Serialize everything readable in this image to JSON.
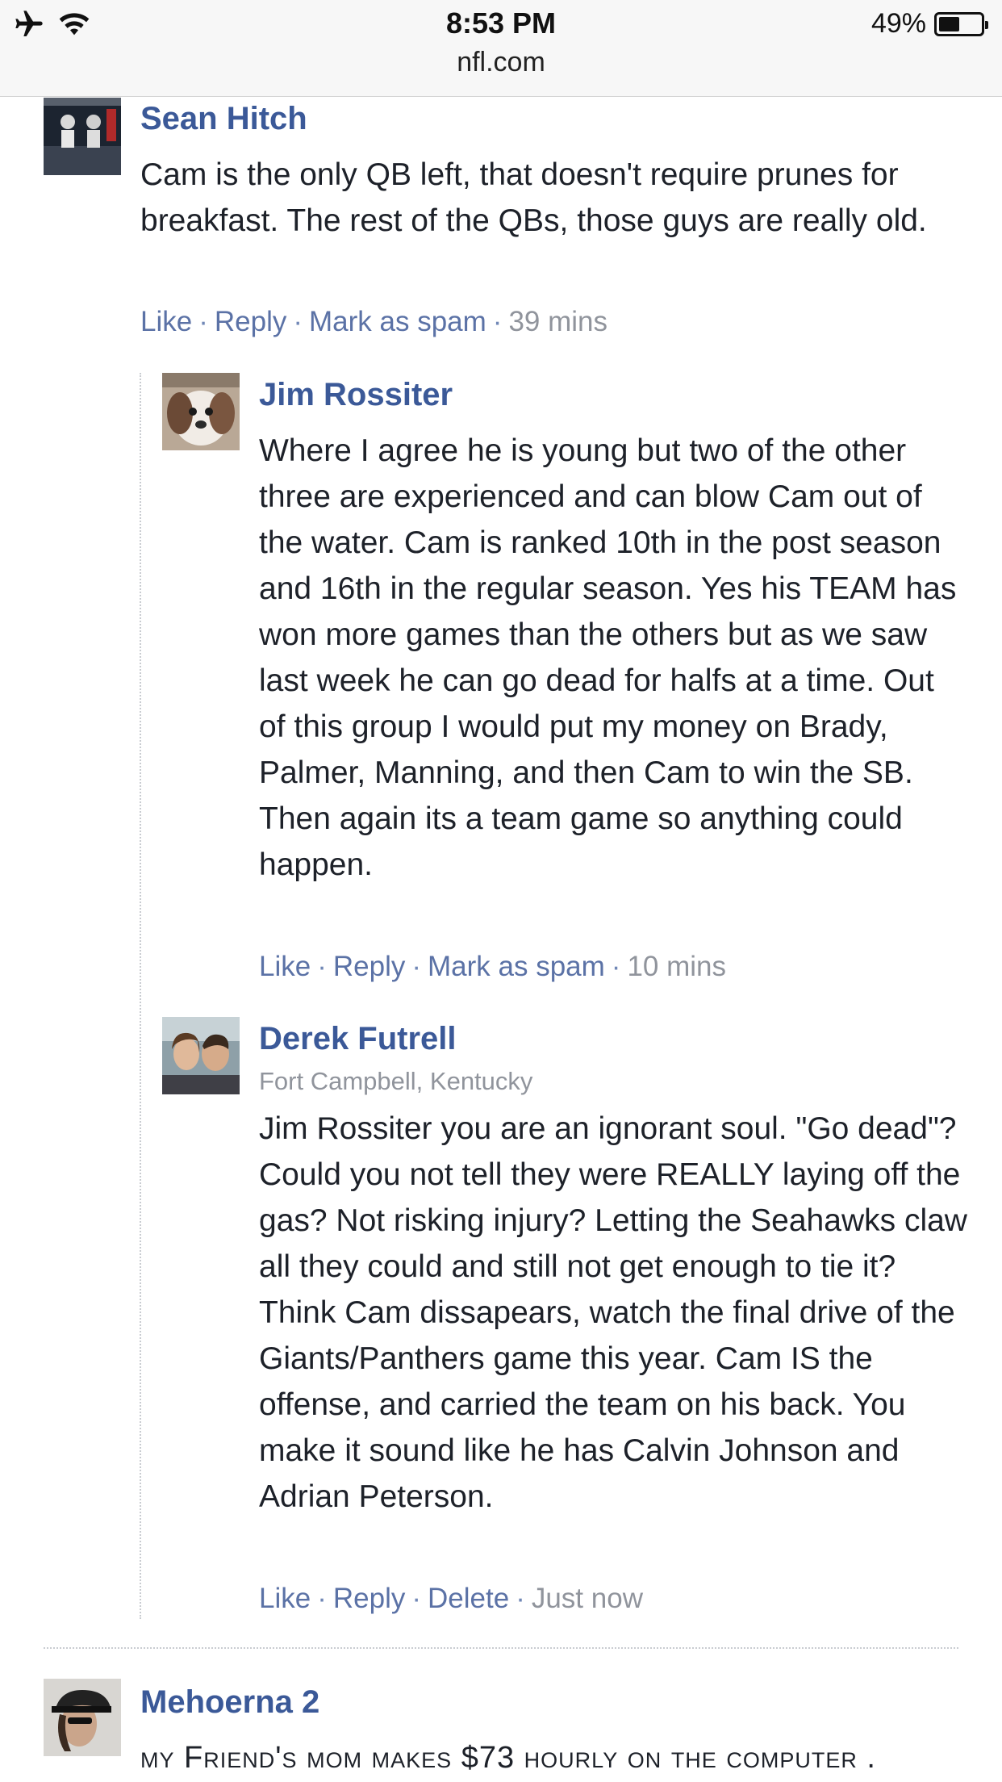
{
  "status_bar": {
    "time": "8:53 PM",
    "battery_percent": "49%",
    "battery_level": 0.49,
    "icons": [
      "airplane-icon",
      "wifi-icon",
      "battery-icon"
    ]
  },
  "browser": {
    "url": "nfl.com"
  },
  "comments": [
    {
      "author": "Sean Hitch",
      "text": "Cam is the only QB left, that doesn't require prunes for breakfast. The rest of the QBs, those guys are really old.",
      "actions": {
        "like": "Like",
        "reply": "Reply",
        "third": "Mark as spam",
        "time": "39 mins"
      }
    },
    {
      "author": "Jim Rossiter",
      "text": "Where I agree he is young but two of the other three are experienced and can blow Cam out of the water. Cam is ranked 10th in the post season and 16th in the regular season. Yes his TEAM has won more games than the others but as we saw last week he can go dead for halfs at a time. Out of this group I would put my money on Brady, Palmer, Manning, and then Cam to win the SB. Then again its a team game so anything could happen.",
      "actions": {
        "like": "Like",
        "reply": "Reply",
        "third": "Mark as spam",
        "time": "10 mins"
      }
    },
    {
      "author": "Derek Futrell",
      "location": "Fort Campbell, Kentucky",
      "text": "Jim Rossiter you are an ignorant soul. \"Go dead\"? Could you not tell they were REALLY laying off the gas? Not risking injury? Letting the Seahawks claw all they could and still not get enough to tie it? Think Cam dissapears, watch the final drive of the Giants/Panthers game this year. Cam IS the offense, and carried the team on his back. You make it sound like he has Calvin Johnson and Adrian Peterson.",
      "actions": {
        "like": "Like",
        "reply": "Reply",
        "third": "Delete",
        "time": "Just now"
      }
    },
    {
      "author": "Mehoerna 2",
      "text": "my Friend's mom makes $73 hourly on the computer ."
    }
  ],
  "separator": "·"
}
